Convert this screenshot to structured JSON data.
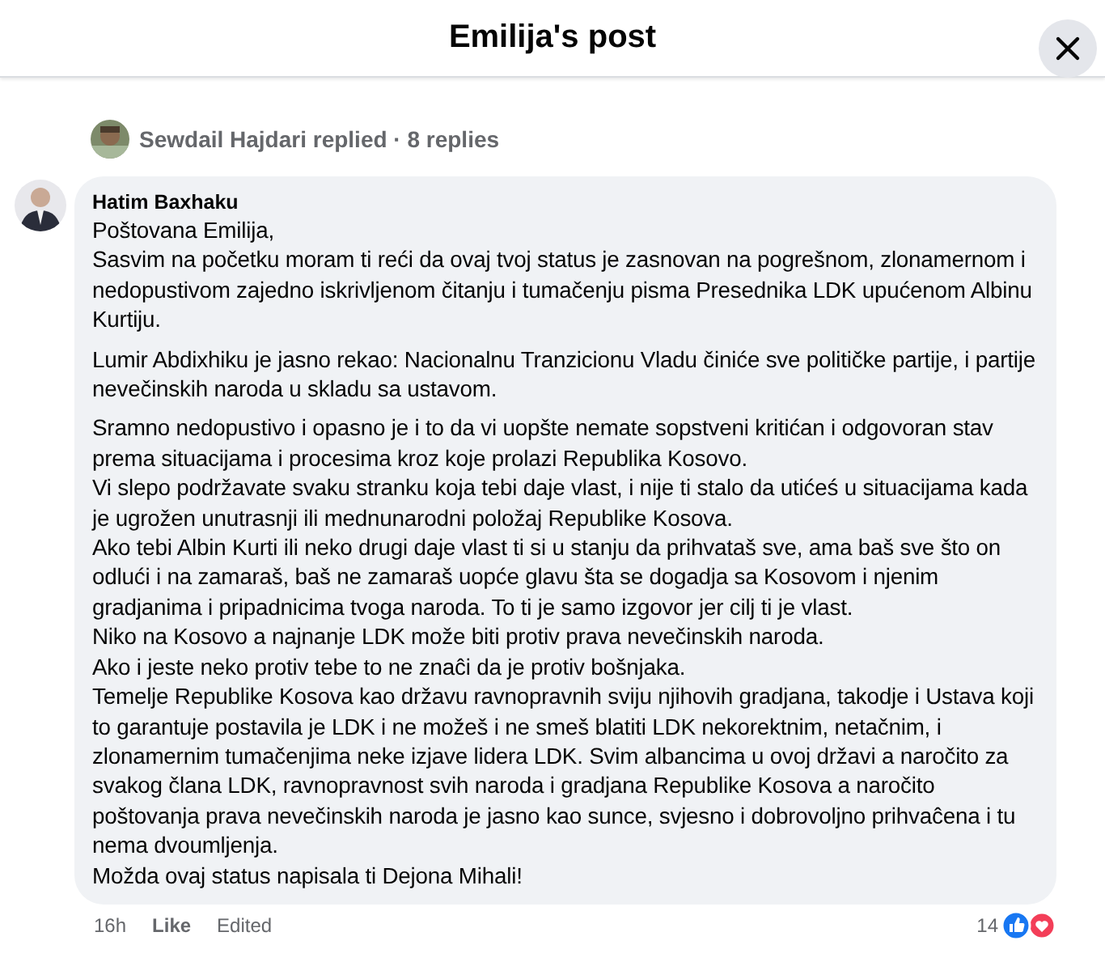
{
  "header": {
    "title": "Emilija's post"
  },
  "replies_link": {
    "text": "Sewdail Hajdari replied · 8 replies"
  },
  "comment": {
    "author": "Hatim Baxhaku",
    "paragraphs": [
      [
        "Poštovana Emilija,",
        "Sasvim na početku moram ti reći da ovaj tvoj status je zasnovan na pogrešnom, zlonamernom i nedopustivom zajedno iskrivljenom čitanju i tumačenju pisma Presednika LDK upućenom Albinu Kurtiju."
      ],
      [
        "Lumir Abdixhiku je jasno rekao: Nacionalnu Tranzicionu Vladu činiće sve političke partije, i partije nevečinskih naroda u skladu sa ustavom."
      ],
      [
        "Sramno nedopustivo i opasno je i to da vi uopšte nemate sopstveni kritićan i odgovoran stav prema situacijama i procesima kroz koje prolazi Republika Kosovo.",
        "Vi slepo podržavate svaku stranku koja tebi daje vlast, i nije ti stalo da utićeś u situacijama kada je ugrožen unutrasnji ili mednunarodni položaj Republike Kosova.",
        "Ako tebi Albin Kurti ili neko drugi daje vlast ti si u stanju da prihvataš sve, ama baš sve što on odlući i na zamaraš, baš ne zamaraš uopće glavu šta se dogadja sa Kosovom i njenim gradjanima i pripadnicima tvoga naroda. To ti je samo izgovor jer cilj ti je vlast.",
        "Niko na Kosovo a najnanje LDK može biti protiv prava nevečinskih naroda.",
        "Ako i jeste neko protiv tebe to ne znaĉi da je protiv bošnjaka.",
        "Temelje Republike Kosova kao državu ravnopravnih sviju njihovih gradjana, takodje i Ustava koji to garantuje postavila je LDK i ne možeš i ne smeš blatiti LDK nekorektnim, netačnim, i zlonamernim tumačenjima neke izjave lidera LDK. Svim albancima u ovoj državi a naročito za svakog člana LDK, ravnopravnost svih naroda i gradjana Republike Kosova a naročito poštovanja prava nevečinskih naroda je jasno kao sunce, svjesno i dobrovoljno prihvaĉena i tu nema dvoumljenja.",
        "Možda ovaj status napisala ti Dejona Mihali!"
      ]
    ],
    "time": "16h",
    "like": "Like",
    "edited": "Edited",
    "reaction_count": "14"
  }
}
